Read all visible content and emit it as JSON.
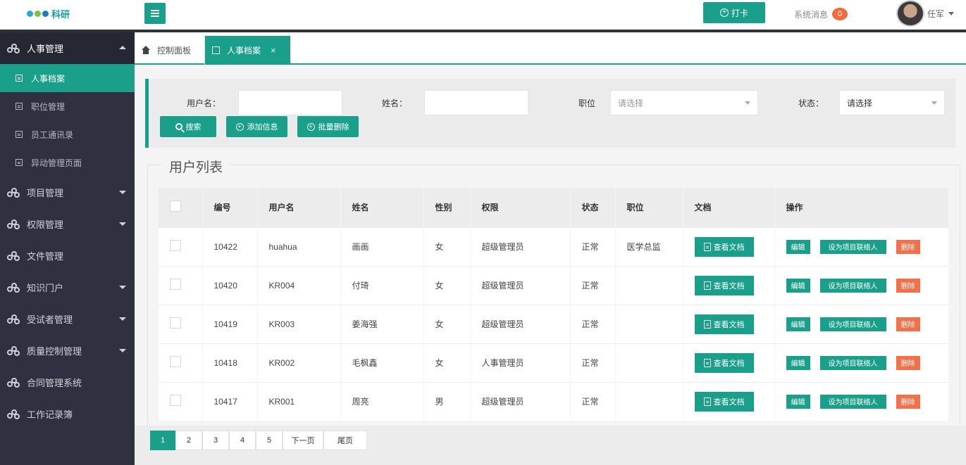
{
  "header": {
    "logo_text": "科研",
    "punch_label": "打卡",
    "sysmsg_label": "系统消息",
    "sysmsg_count": "0",
    "user_name": "任军",
    "colors": {
      "accent": "#1aa08a",
      "badge": "#f26b3a",
      "sidebar": "#2f3140"
    }
  },
  "sidebar": {
    "groups": [
      {
        "label": "人事管理",
        "open": true
      },
      {
        "label": "项目管理"
      },
      {
        "label": "权限管理"
      },
      {
        "label": "文件管理"
      },
      {
        "label": "知识门户"
      },
      {
        "label": "受试者管理"
      },
      {
        "label": "质量控制管理"
      },
      {
        "label": "合同管理系统"
      },
      {
        "label": "工作记录簿"
      }
    ],
    "sub_items": [
      "人事档案",
      "职位管理",
      "员工通讯录",
      "异动管理页面"
    ]
  },
  "tabs": {
    "home": "控制面板",
    "current": "人事档案"
  },
  "search": {
    "username_label": "用户名：",
    "name_label": "姓名：",
    "position_label": "职位",
    "position_placeholder": "请选择",
    "status_label": "状态：",
    "status_value": "请选择",
    "search_btn": "搜索",
    "add_btn": "添加信息",
    "batch_delete_btn": "批量删除"
  },
  "list": {
    "title": "用户列表",
    "columns": [
      "编号",
      "用户名",
      "姓名",
      "性别",
      "权限",
      "状态",
      "职位",
      "文档",
      "操作"
    ],
    "rows": [
      {
        "id": "10422",
        "username": "huahua",
        "name": "画画",
        "gender": "女",
        "role": "超级管理员",
        "status": "正常",
        "position": "医学总监"
      },
      {
        "id": "10420",
        "username": "KR004",
        "name": "付琦",
        "gender": "女",
        "role": "超级管理员",
        "status": "正常",
        "position": ""
      },
      {
        "id": "10419",
        "username": "KR003",
        "name": "姜海强",
        "gender": "女",
        "role": "超级管理员",
        "status": "正常",
        "position": ""
      },
      {
        "id": "10418",
        "username": "KR002",
        "name": "毛枫鑫",
        "gender": "女",
        "role": "人事管理员",
        "status": "正常",
        "position": ""
      },
      {
        "id": "10417",
        "username": "KR001",
        "name": "周亮",
        "gender": "男",
        "role": "超级管理员",
        "status": "正常",
        "position": ""
      }
    ],
    "doc_btn": "查看文档",
    "op_edit": "编辑",
    "op_set": "设为项目联络人",
    "op_delete": "删除"
  },
  "pager": {
    "pages": [
      "1",
      "2",
      "3",
      "4",
      "5"
    ],
    "next": "下一页",
    "last": "尾页"
  }
}
